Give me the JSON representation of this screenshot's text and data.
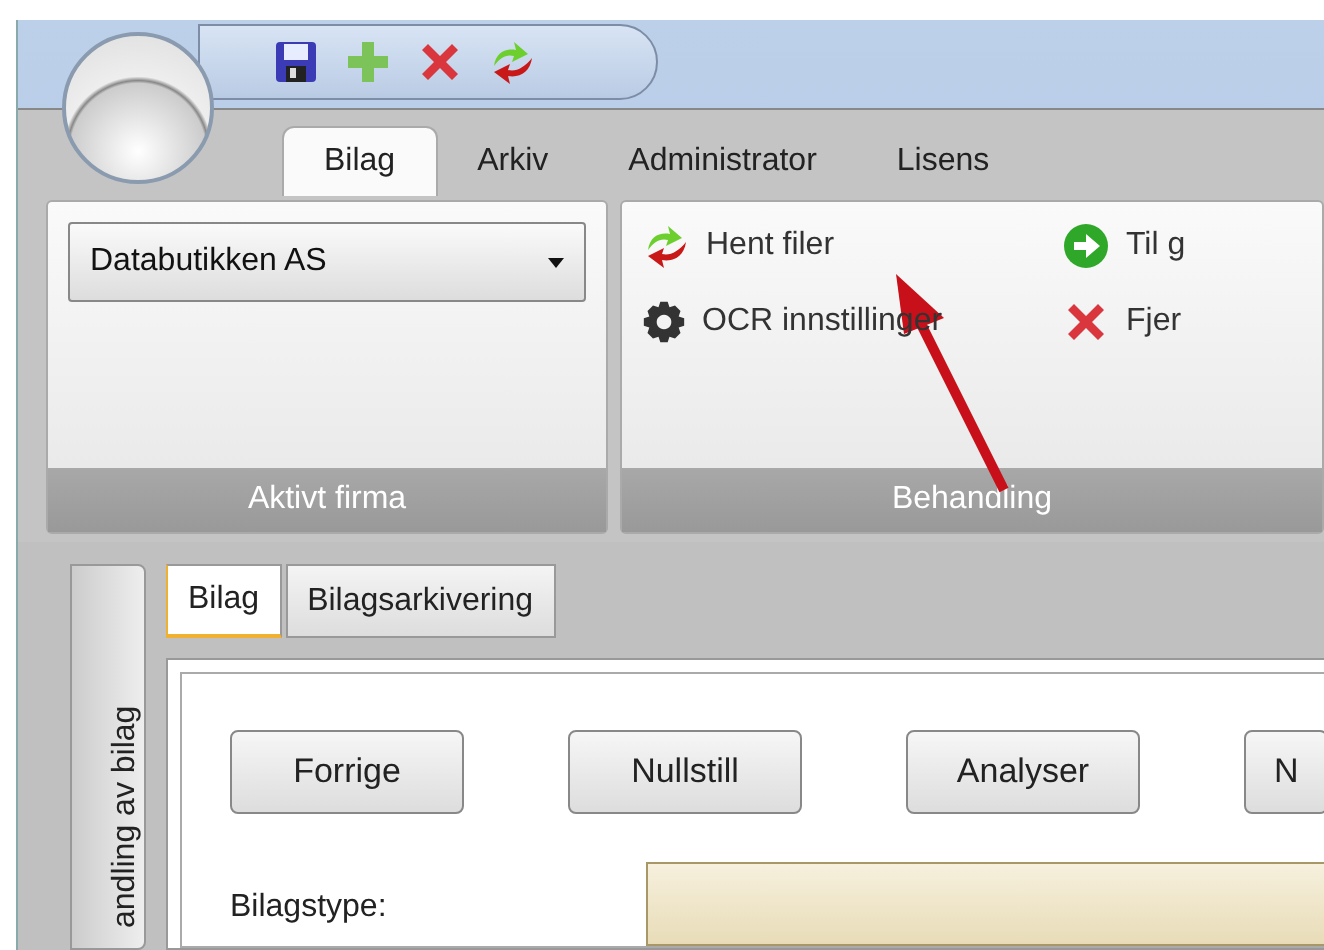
{
  "quick_access": [
    {
      "kind": "save"
    },
    {
      "kind": "add"
    },
    {
      "kind": "delete"
    },
    {
      "kind": "fetch"
    }
  ],
  "ribbon_tabs": [
    {
      "label": "Bilag",
      "selected": true
    },
    {
      "label": "Arkiv",
      "selected": false
    },
    {
      "label": "Administrator",
      "selected": false
    },
    {
      "label": "Lisens",
      "selected": false
    }
  ],
  "groups": [
    {
      "kind": "combo",
      "label": "Aktivt firma",
      "value": "Databutikken AS"
    },
    {
      "kind": "commands",
      "label": "Behandling",
      "commands": [
        {
          "kind": "fetch",
          "label": "Hent filer"
        },
        {
          "kind": "gear",
          "label": "OCR innstillinger"
        },
        {
          "kind": "go",
          "label": "Til g"
        },
        {
          "kind": "delete",
          "label": "Fjer"
        }
      ]
    }
  ],
  "side_tab": {
    "label": "andling av bilag"
  },
  "tabs": [
    {
      "label": "Bilag",
      "selected": true
    },
    {
      "label": "Bilagsarkivering",
      "selected": false
    }
  ],
  "buttons": [
    "Forrige",
    "Nullstill",
    "Analyser",
    "N"
  ],
  "field": {
    "label": "Bilagstype:"
  }
}
